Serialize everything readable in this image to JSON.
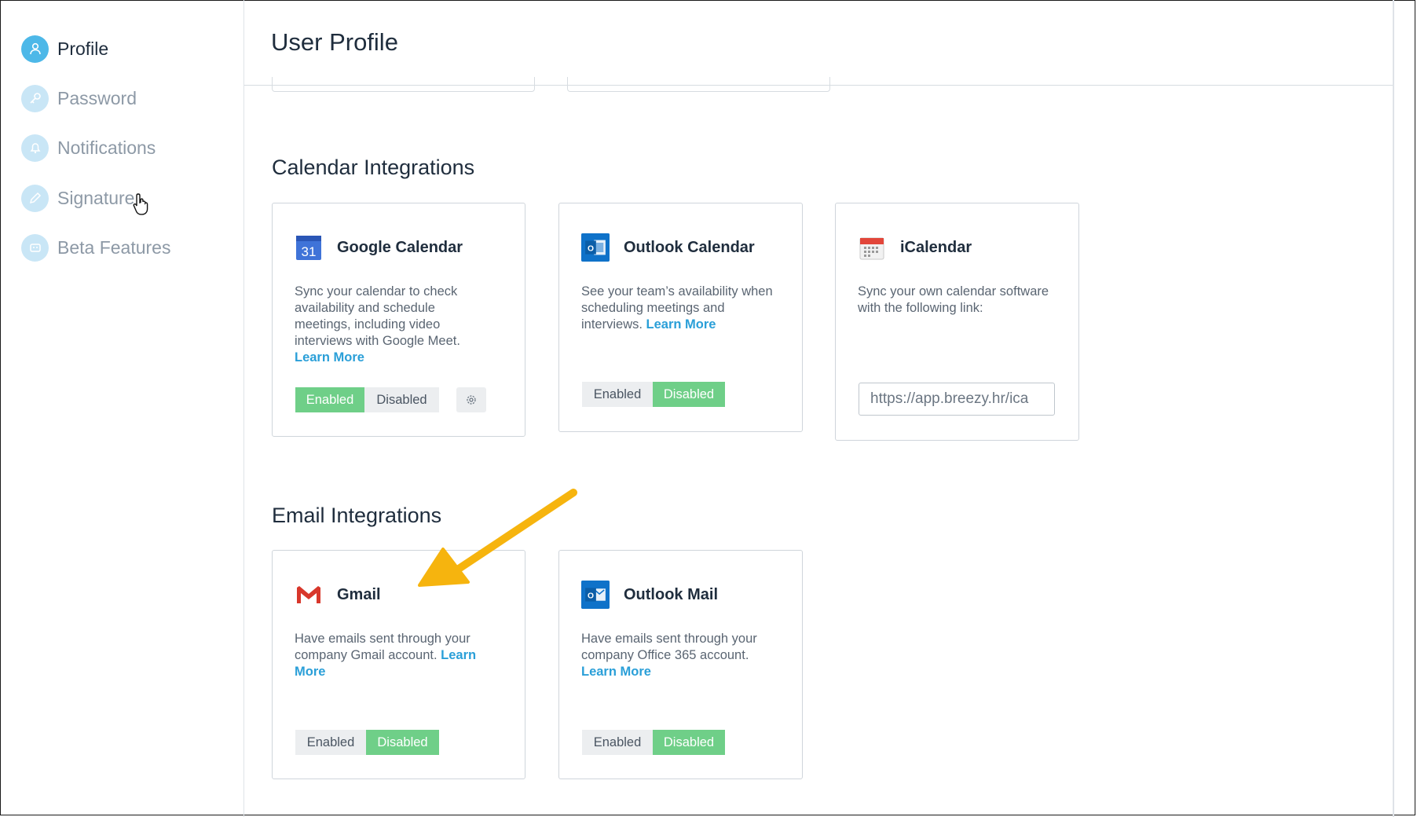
{
  "sidebar": {
    "items": [
      {
        "label": "Profile",
        "icon": "user-icon",
        "active": true
      },
      {
        "label": "Password",
        "icon": "key-icon",
        "active": false
      },
      {
        "label": "Notifications",
        "icon": "bell-icon",
        "active": false
      },
      {
        "label": "Signature",
        "icon": "pencil-icon",
        "active": false
      },
      {
        "label": "Beta Features",
        "icon": "robot-icon",
        "active": false
      }
    ]
  },
  "header": {
    "title": "User Profile"
  },
  "calendar": {
    "title": "Calendar Integrations",
    "google": {
      "name": "Google Calendar",
      "logo_text": "31",
      "desc": "Sync your calendar to check availability and schedule meetings, including video interviews with Google Meet. ",
      "learn": "Learn More",
      "enabled": "Enabled",
      "disabled": "Disabled",
      "state": "enabled"
    },
    "outlook": {
      "name": "Outlook Calendar",
      "desc": "See your team’s availability when scheduling meetings and interviews. ",
      "learn": "Learn More",
      "enabled": "Enabled",
      "disabled": "Disabled",
      "state": "disabled"
    },
    "ical": {
      "name": "iCalendar",
      "desc": "Sync your own calendar software with the following link:",
      "link_value": "https://app.breezy.hr/ica"
    }
  },
  "email": {
    "title": "Email Integrations",
    "gmail": {
      "name": "Gmail",
      "desc": "Have emails sent through your company Gmail account. ",
      "learn": "Learn More",
      "enabled": "Enabled",
      "disabled": "Disabled",
      "state": "disabled"
    },
    "outlook": {
      "name": "Outlook Mail",
      "desc": "Have emails sent through your company Office 365 account. ",
      "learn": "Learn More",
      "enabled": "Enabled",
      "disabled": "Disabled",
      "state": "disabled"
    }
  },
  "colors": {
    "accent": "#2a9fd8",
    "enabled_green": "#6fcf88",
    "annotation_arrow": "#f6b40e"
  }
}
